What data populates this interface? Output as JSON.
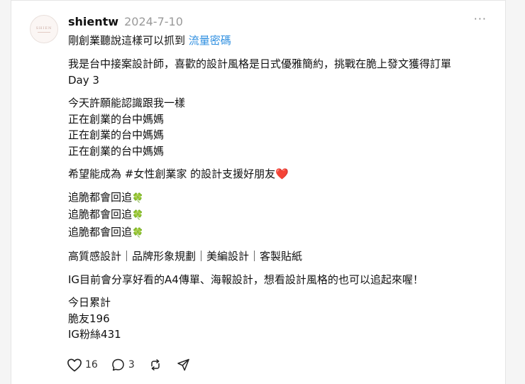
{
  "post": {
    "username": "shientw",
    "date": "2024-7-10",
    "avatar_text": "SHIEN",
    "more_label": "···",
    "topic_prefix": "剛創業聽說這樣可以抓到",
    "topic_tag": "流量密碼",
    "paragraphs": [
      [
        "我是台中接案設計師，喜歡的設計風格是日式優雅簡約，挑戰在脆上發文獲得訂單",
        "Day 3"
      ],
      [
        "今天許願能認識跟我一樣",
        "正在創業的台中媽媽",
        "正在創業的台中媽媽",
        "正在創業的台中媽媽"
      ],
      [
        "希望能成為 #女性創業家 的設計支援好朋友"
      ],
      [
        "追脆都會回追",
        "追脆都會回追",
        "追脆都會回追"
      ],
      [
        "高質感設計｜品牌形象規劃｜美編設計｜客製貼紙"
      ],
      [
        "IG目前會分享好看的A4傳單、海報設計，想看設計風格的也可以追起來喔！"
      ],
      [
        "今日累計",
        "脆友196",
        "IG粉絲431"
      ]
    ],
    "heart_emoji": "❤️",
    "clover_emoji": "🍀",
    "actions": {
      "like_count": "16",
      "reply_count": "3"
    }
  }
}
